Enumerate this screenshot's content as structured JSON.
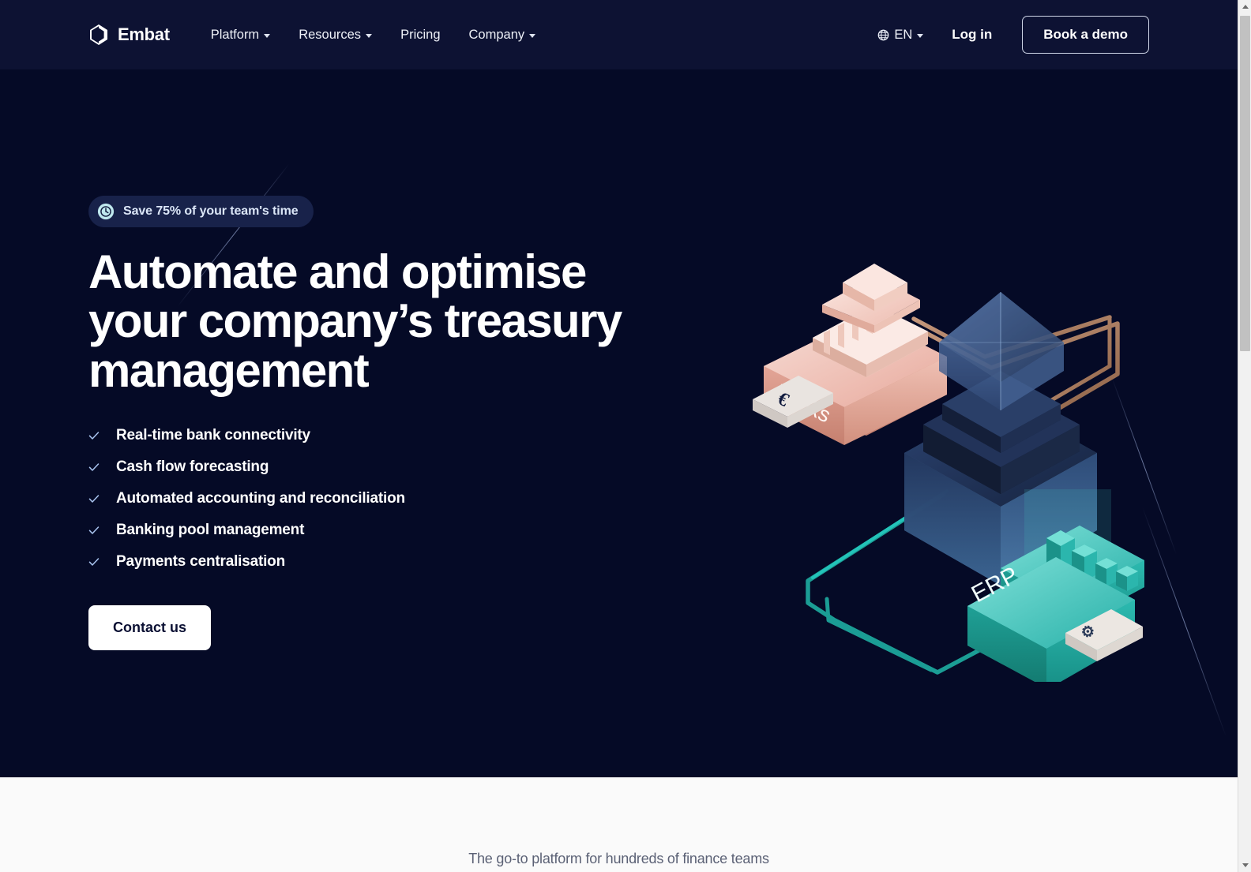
{
  "header": {
    "brand": {
      "name": "Embat",
      "logo_icon": "embat-diamond-logo"
    },
    "nav": [
      {
        "label": "Platform",
        "has_dropdown": true
      },
      {
        "label": "Resources",
        "has_dropdown": true
      },
      {
        "label": "Pricing",
        "has_dropdown": false
      },
      {
        "label": "Company",
        "has_dropdown": true
      }
    ],
    "language": {
      "label": "EN",
      "icon": "globe-icon",
      "has_dropdown": true
    },
    "login_label": "Log in",
    "demo_label": "Book a demo"
  },
  "hero": {
    "badge": {
      "text": "Save 75% of your team's time",
      "icon": "clock-icon"
    },
    "headline": "Automate and optimise your company’s treasury management",
    "features": [
      "Real-time bank connectivity",
      "Cash flow forecasting",
      "Automated accounting and reconciliation",
      "Banking pool management",
      "Payments centralisation"
    ],
    "cta_label": "Contact us",
    "illustration": {
      "name": "treasury-integration-3d-illustration",
      "labels": [
        "Banks",
        "ERP"
      ],
      "card_symbols": [
        "euro-symbol",
        "cog-symbol"
      ],
      "nodes": [
        "bank-building-block",
        "crystal-core-block",
        "erp-chart-block"
      ]
    }
  },
  "band": {
    "tagline": "The go-to platform for hundreds of finance teams"
  },
  "scrollbar": {
    "up_icon": "scroll-up-arrow",
    "down_icon": "scroll-down-arrow"
  },
  "colors": {
    "header_bg": "#0d1233",
    "hero_bg": "#050a26",
    "badge_bg": "#18224a",
    "badge_accent": "#bfe8ee",
    "check": "#a9c4ef",
    "band_bg": "#fafafa",
    "cta_bg": "#ffffff",
    "cta_text": "#0b1033",
    "pink": "#f0b9ae",
    "teal": "#2fb3ab",
    "navy_crystal": "#1d2c52"
  }
}
